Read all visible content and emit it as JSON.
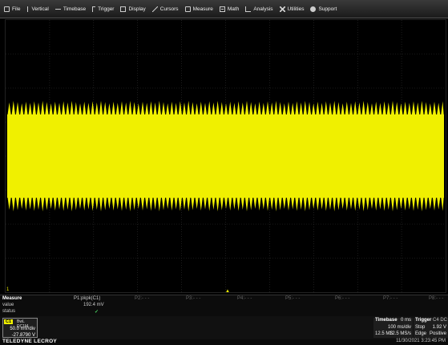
{
  "colors": {
    "trace": "#f0f000",
    "grid": "#2f2f2f",
    "check": "#4cd964"
  },
  "menu": [
    {
      "label": "File",
      "icon": "file-icon",
      "cls": "icon-file"
    },
    {
      "label": "Vertical",
      "icon": "vertical-arrows-icon",
      "cls": "icon-vertical"
    },
    {
      "label": "Timebase",
      "icon": "horizontal-arrows-icon",
      "cls": "icon-timebase"
    },
    {
      "label": "Trigger",
      "icon": "trigger-icon",
      "cls": "icon-trigger"
    },
    {
      "label": "Display",
      "icon": "display-icon",
      "cls": "icon-display"
    },
    {
      "label": "Cursors",
      "icon": "cursors-icon",
      "cls": "icon-cursors"
    },
    {
      "label": "Measure",
      "icon": "measure-icon",
      "cls": "icon-measure"
    },
    {
      "label": "Math",
      "icon": "math-icon",
      "cls": "icon-math"
    },
    {
      "label": "Analysis",
      "icon": "analysis-icon",
      "cls": "icon-analysis"
    },
    {
      "label": "Utilities",
      "icon": "utilities-icon",
      "cls": "icon-utilities"
    },
    {
      "label": "Support",
      "icon": "support-icon",
      "cls": "icon-support"
    }
  ],
  "screen": {
    "channel_marker": "1",
    "trigger_marker": "▲"
  },
  "measure": {
    "title": "Measure",
    "row_labels": [
      "value",
      "status"
    ],
    "p1": {
      "label": "P1:pkpk(C1)",
      "value": "192.4 mV",
      "status": "✓"
    },
    "empty_params": [
      "P2:- - -",
      "P3:- - -",
      "P4:- - -",
      "P5:- - -",
      "P6:- - -",
      "P7:- - -",
      "P8:- - -"
    ]
  },
  "channel1": {
    "tag": "C1",
    "coupling": "BwL DC1M",
    "vdiv": "50.0 mV/div",
    "offset": "-27.8790 V"
  },
  "timebase": {
    "title": "Timebase",
    "delay": "0 ms",
    "tdiv": "100 ms/div",
    "samples": "12.5 MS",
    "rate": "12.5 MS/s"
  },
  "trigger": {
    "title": "Trigger",
    "mode_badge": "C4 DC",
    "level": "1.92 V",
    "state": "Stop",
    "type": "Edge",
    "slope": "Positive"
  },
  "status": {
    "brand": "TELEDYNE LECROY",
    "datetime": "11/30/2021 3:23:45 PM"
  }
}
